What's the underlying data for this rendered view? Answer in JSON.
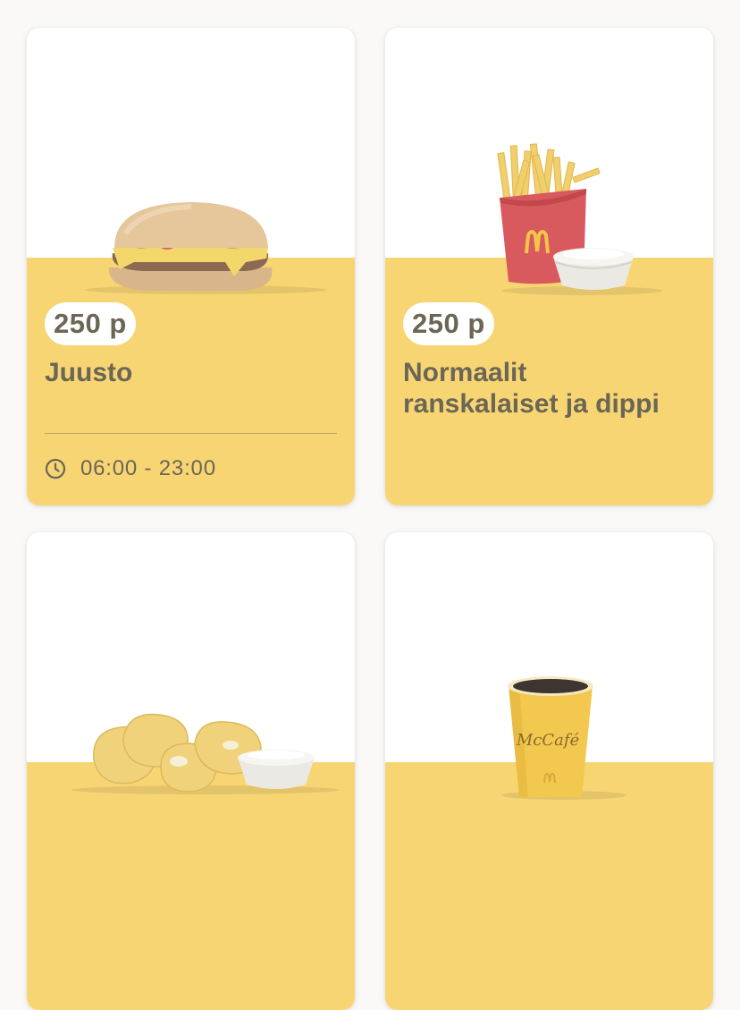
{
  "offers": [
    {
      "price": "250 p",
      "title": "Juusto",
      "hours": "06:00 - 23:00",
      "image": "cheeseburger"
    },
    {
      "price": "250 p",
      "title": "Normaalit ranskalaiset ja dippi",
      "image": "fries-and-dip"
    },
    {
      "image": "chicken-nuggets-and-dip"
    },
    {
      "image": "mccafe-coffee-cup",
      "logo_text": "McCafé"
    }
  ],
  "colors": {
    "band": "#f8d573",
    "text": "#6b6655",
    "background": "#faf9f7"
  }
}
